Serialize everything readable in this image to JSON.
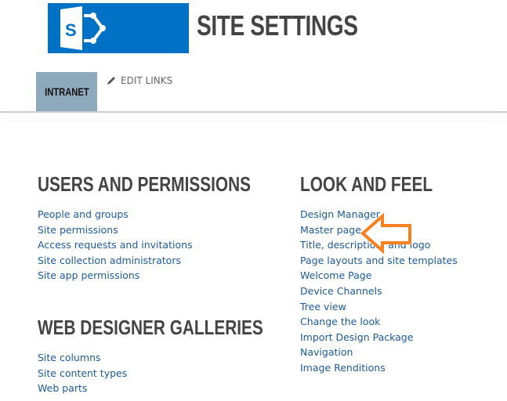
{
  "header": {
    "logo_letter": "S",
    "title": "SITE SETTINGS",
    "brand_color": "#0072c6"
  },
  "nav": {
    "tab": "INTRANET",
    "edit_links": "EDIT LINKS"
  },
  "sections": [
    {
      "title": "USERS AND PERMISSIONS",
      "items": [
        "People and groups",
        "Site permissions",
        "Access requests and invitations",
        "Site collection administrators",
        "Site app permissions"
      ]
    },
    {
      "title": "WEB DESIGNER GALLERIES",
      "items": [
        "Site columns",
        "Site content types",
        "Web parts"
      ]
    },
    {
      "title": "LOOK AND FEEL",
      "items": [
        "Design Manager",
        "Master page",
        "Title, description, and logo",
        "Page layouts and site templates",
        "Welcome Page",
        "Device Channels",
        "Tree view",
        "Change the look",
        "Import Design Package",
        "Navigation",
        "Image Renditions"
      ]
    }
  ],
  "annotation": {
    "icon": "arrow-left-icon",
    "color": "#f7801f"
  }
}
